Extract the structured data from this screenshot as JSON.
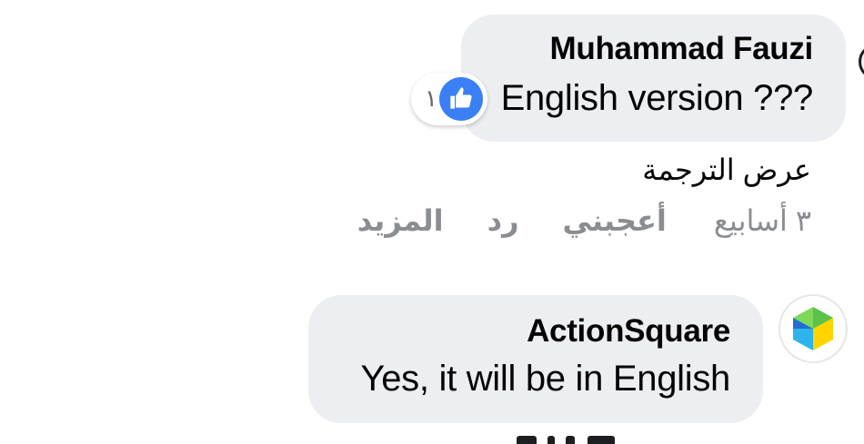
{
  "comment1": {
    "author": "Muhammad Fauzi",
    "text": "English version ???",
    "reaction": {
      "icon": "like-icon",
      "count": "١",
      "color": "#3b7ff5"
    },
    "see_translation": "عرض الترجمة",
    "actions": {
      "time": "٣ أسابيع",
      "like": "أعجبني",
      "reply": "رد",
      "more": "المزيد"
    }
  },
  "comment2": {
    "author": "ActionSquare",
    "text": "Yes, it will be in English",
    "avatar": {
      "icon": "actionsquare-logo-icon",
      "colors": [
        "#2db4ea",
        "#ffd400",
        "#7ed957",
        "#1f6fd1"
      ]
    }
  },
  "colors": {
    "bubble": "#eceef2",
    "meta_text": "#8a8d91",
    "primary_text": "#050505"
  }
}
